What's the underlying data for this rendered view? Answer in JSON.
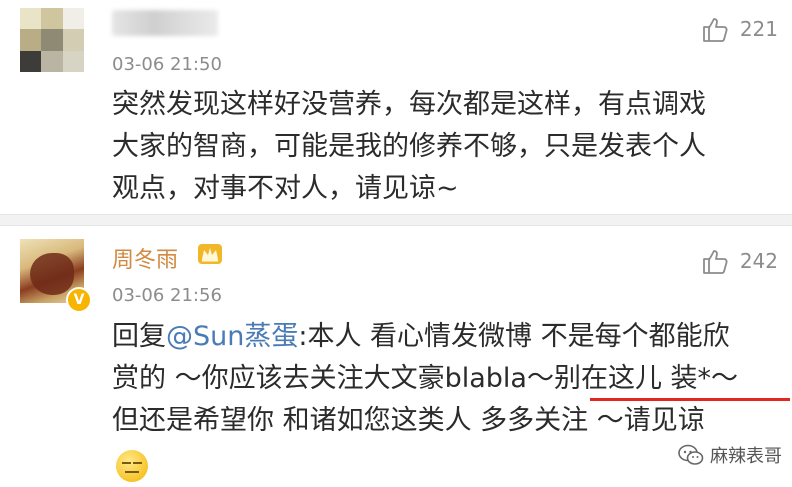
{
  "comments": [
    {
      "author": "",
      "date": "03-06 21:50",
      "likes": "221",
      "lines": [
        "突然发现这样好没营养，每次都是这样，有点调戏",
        "大家的智商，可能是我的修养不够，只是发表个人",
        "观点，对事不对人，请见谅~"
      ]
    },
    {
      "author": "周冬雨",
      "date": "03-06 21:56",
      "likes": "242",
      "reply_prefix": "回复",
      "mention": "@Sun蒸蛋",
      "line1_rest": ":本人 看心情发微博 不是每个都能欣",
      "line2": "赏的 ～你应该去关注大文豪blabla～别在这儿 装*～",
      "line3": "但还是希望你 和诸如您这类人 多多关注 ～请见谅",
      "verified_badge": "V",
      "emoji": "smile-emoji"
    }
  ],
  "watermark": {
    "text": "麻辣表哥",
    "icon": "wechat-icon"
  },
  "colors": {
    "author_name": "#d08a42",
    "mention": "#4a7bb5",
    "highlight_underline": "#e0281f",
    "meta_gray": "#8c8c8c",
    "verified": "#f7b500"
  }
}
